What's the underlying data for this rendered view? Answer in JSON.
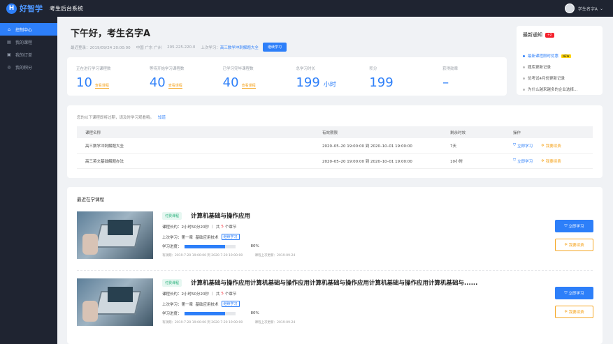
{
  "header": {
    "logo_text": "好智学",
    "system_name": "考生后台系统",
    "user_name": "学生名字A"
  },
  "sidebar": {
    "items": [
      {
        "label": "控制中心",
        "icon": "home-icon"
      },
      {
        "label": "我的课程",
        "icon": "book-icon"
      },
      {
        "label": "我的订单",
        "icon": "order-icon"
      },
      {
        "label": "我的积分",
        "icon": "points-icon"
      }
    ]
  },
  "greeting": {
    "title": "下午好，考生名字A",
    "last_login": "最近登录：2019/09/24 20:00:00",
    "location": "中国 广东 广州",
    "ip": "205.225.220.0",
    "last_study_label": "上次学习：",
    "last_study_course": "高三数学冲刺解题大全",
    "continue_button": "继续学习"
  },
  "stats": [
    {
      "label": "正在进行学习课程数",
      "value": "10",
      "link": "查看课程"
    },
    {
      "label": "等待开始学习课程数",
      "value": "40",
      "link": "查看课程"
    },
    {
      "label": "已学习完毕课程数",
      "value": "40",
      "link": "查看课程"
    },
    {
      "label": "总学习时长",
      "value": "199",
      "unit": "小时"
    },
    {
      "label": "积分",
      "value": "199"
    },
    {
      "label": "获得勋章",
      "value": "–"
    }
  ],
  "notice": {
    "title": "最新通知",
    "badge": "+2",
    "items": [
      {
        "text": "最新课程限时优惠",
        "new": "NEW"
      },
      {
        "text": "题库更新记录"
      },
      {
        "text": "优考试4月份更新记录"
      },
      {
        "text": "为什么越来越多的企业选择..."
      }
    ]
  },
  "expiring": {
    "tip": "您的以下课程即将过期，请及时学习观看哦。",
    "know_link": "知道",
    "columns": [
      "课程名称",
      "有效期限",
      "剩余时效",
      "操作"
    ],
    "rows": [
      {
        "name": "高三数学冲刺解题大全",
        "period": "2020–05–20  19:00:00 到 2020–10–01  19:00:00",
        "remaining": "7天",
        "study": "立即学习",
        "renew": "我要续费"
      },
      {
        "name": "高三英文基础解题办法",
        "period": "2020–05–20  19:00:00 到 2020–10–01  19:00:00",
        "remaining": "10小时",
        "study": "立即学习",
        "renew": "我要续费"
      }
    ]
  },
  "recent": {
    "title": "最近在学课程",
    "courses": [
      {
        "tag": "付费课程",
        "name": "计算机基础与操作应用",
        "duration_label": "课程长约：",
        "duration": "2小时50分20秒",
        "chapters_prefix": "共",
        "chapters_count": "5",
        "chapters_suffix": "个章节",
        "last_label": "上次学习：",
        "last_chapter": "第一章",
        "last_section": "基础应用技术",
        "change_link": "继续学习",
        "progress_label": "学习进度：",
        "progress_pct": 80,
        "progress_text": "80%",
        "validity": "有效期：2019-7-20  19:00:00 到 2020-7-20  19:00:00",
        "updated": "课程上次更新：2019-09-24",
        "study_button": "立即学习",
        "renew_button": "我要续费"
      },
      {
        "tag": "付费课程",
        "name": "计算机基础与操作应用计算机基础与操作应用计算机基础与操作应用计算机基础与操作应用计算机基础与......",
        "duration_label": "课程长约：",
        "duration": "2小时50分20秒",
        "chapters_prefix": "共",
        "chapters_count": "5",
        "chapters_suffix": "个章节",
        "last_label": "上次学习：",
        "last_chapter": "第一章",
        "last_section": "基础应用技术",
        "change_link": "继续学习",
        "progress_label": "学习进度：",
        "progress_pct": 80,
        "progress_text": "80%",
        "validity": "有效期：2019-7-20  19:00:00 到 2020-7-20  19:00:00",
        "updated": "课程上次更新：2019-09-24",
        "study_button": "立即学习",
        "renew_button": "我要续费"
      }
    ]
  },
  "colors": {
    "primary": "#2d7ff9",
    "sidebar": "#1f2431",
    "accent_orange": "#f5a623",
    "badge_red": "#f5222d"
  }
}
